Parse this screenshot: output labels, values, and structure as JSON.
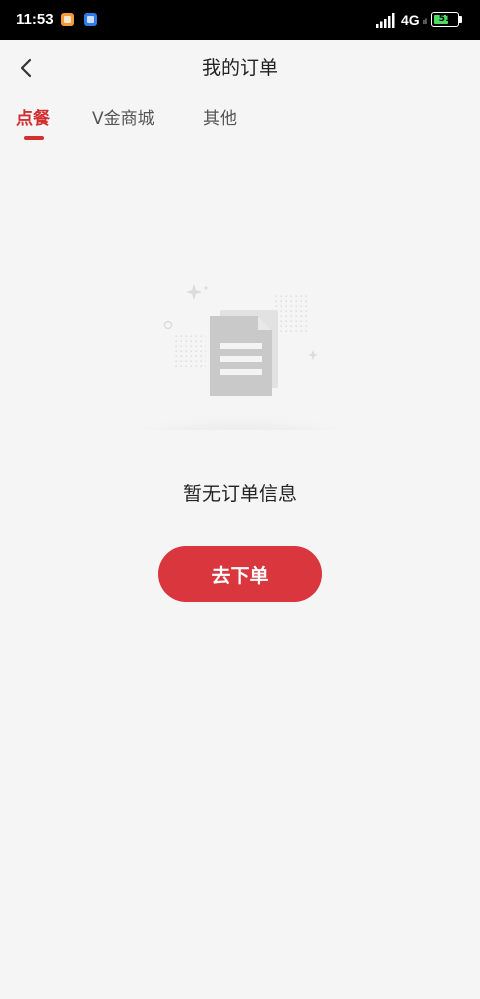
{
  "status_bar": {
    "time": "11:53",
    "network": "4G",
    "network_sub": "ıl",
    "battery": "51"
  },
  "header": {
    "title": "我的订单",
    "back_icon": "chevron-left-icon"
  },
  "tabs": [
    {
      "label": "点餐",
      "active": true
    },
    {
      "label": "V金商城",
      "active": false
    },
    {
      "label": "其他",
      "active": false
    }
  ],
  "empty_state": {
    "icon": "document-icon",
    "message": "暂无订单信息",
    "action_label": "去下单"
  },
  "colors": {
    "accent": "#d9363e",
    "tab_active": "#d32f2f",
    "background": "#f5f5f5"
  }
}
